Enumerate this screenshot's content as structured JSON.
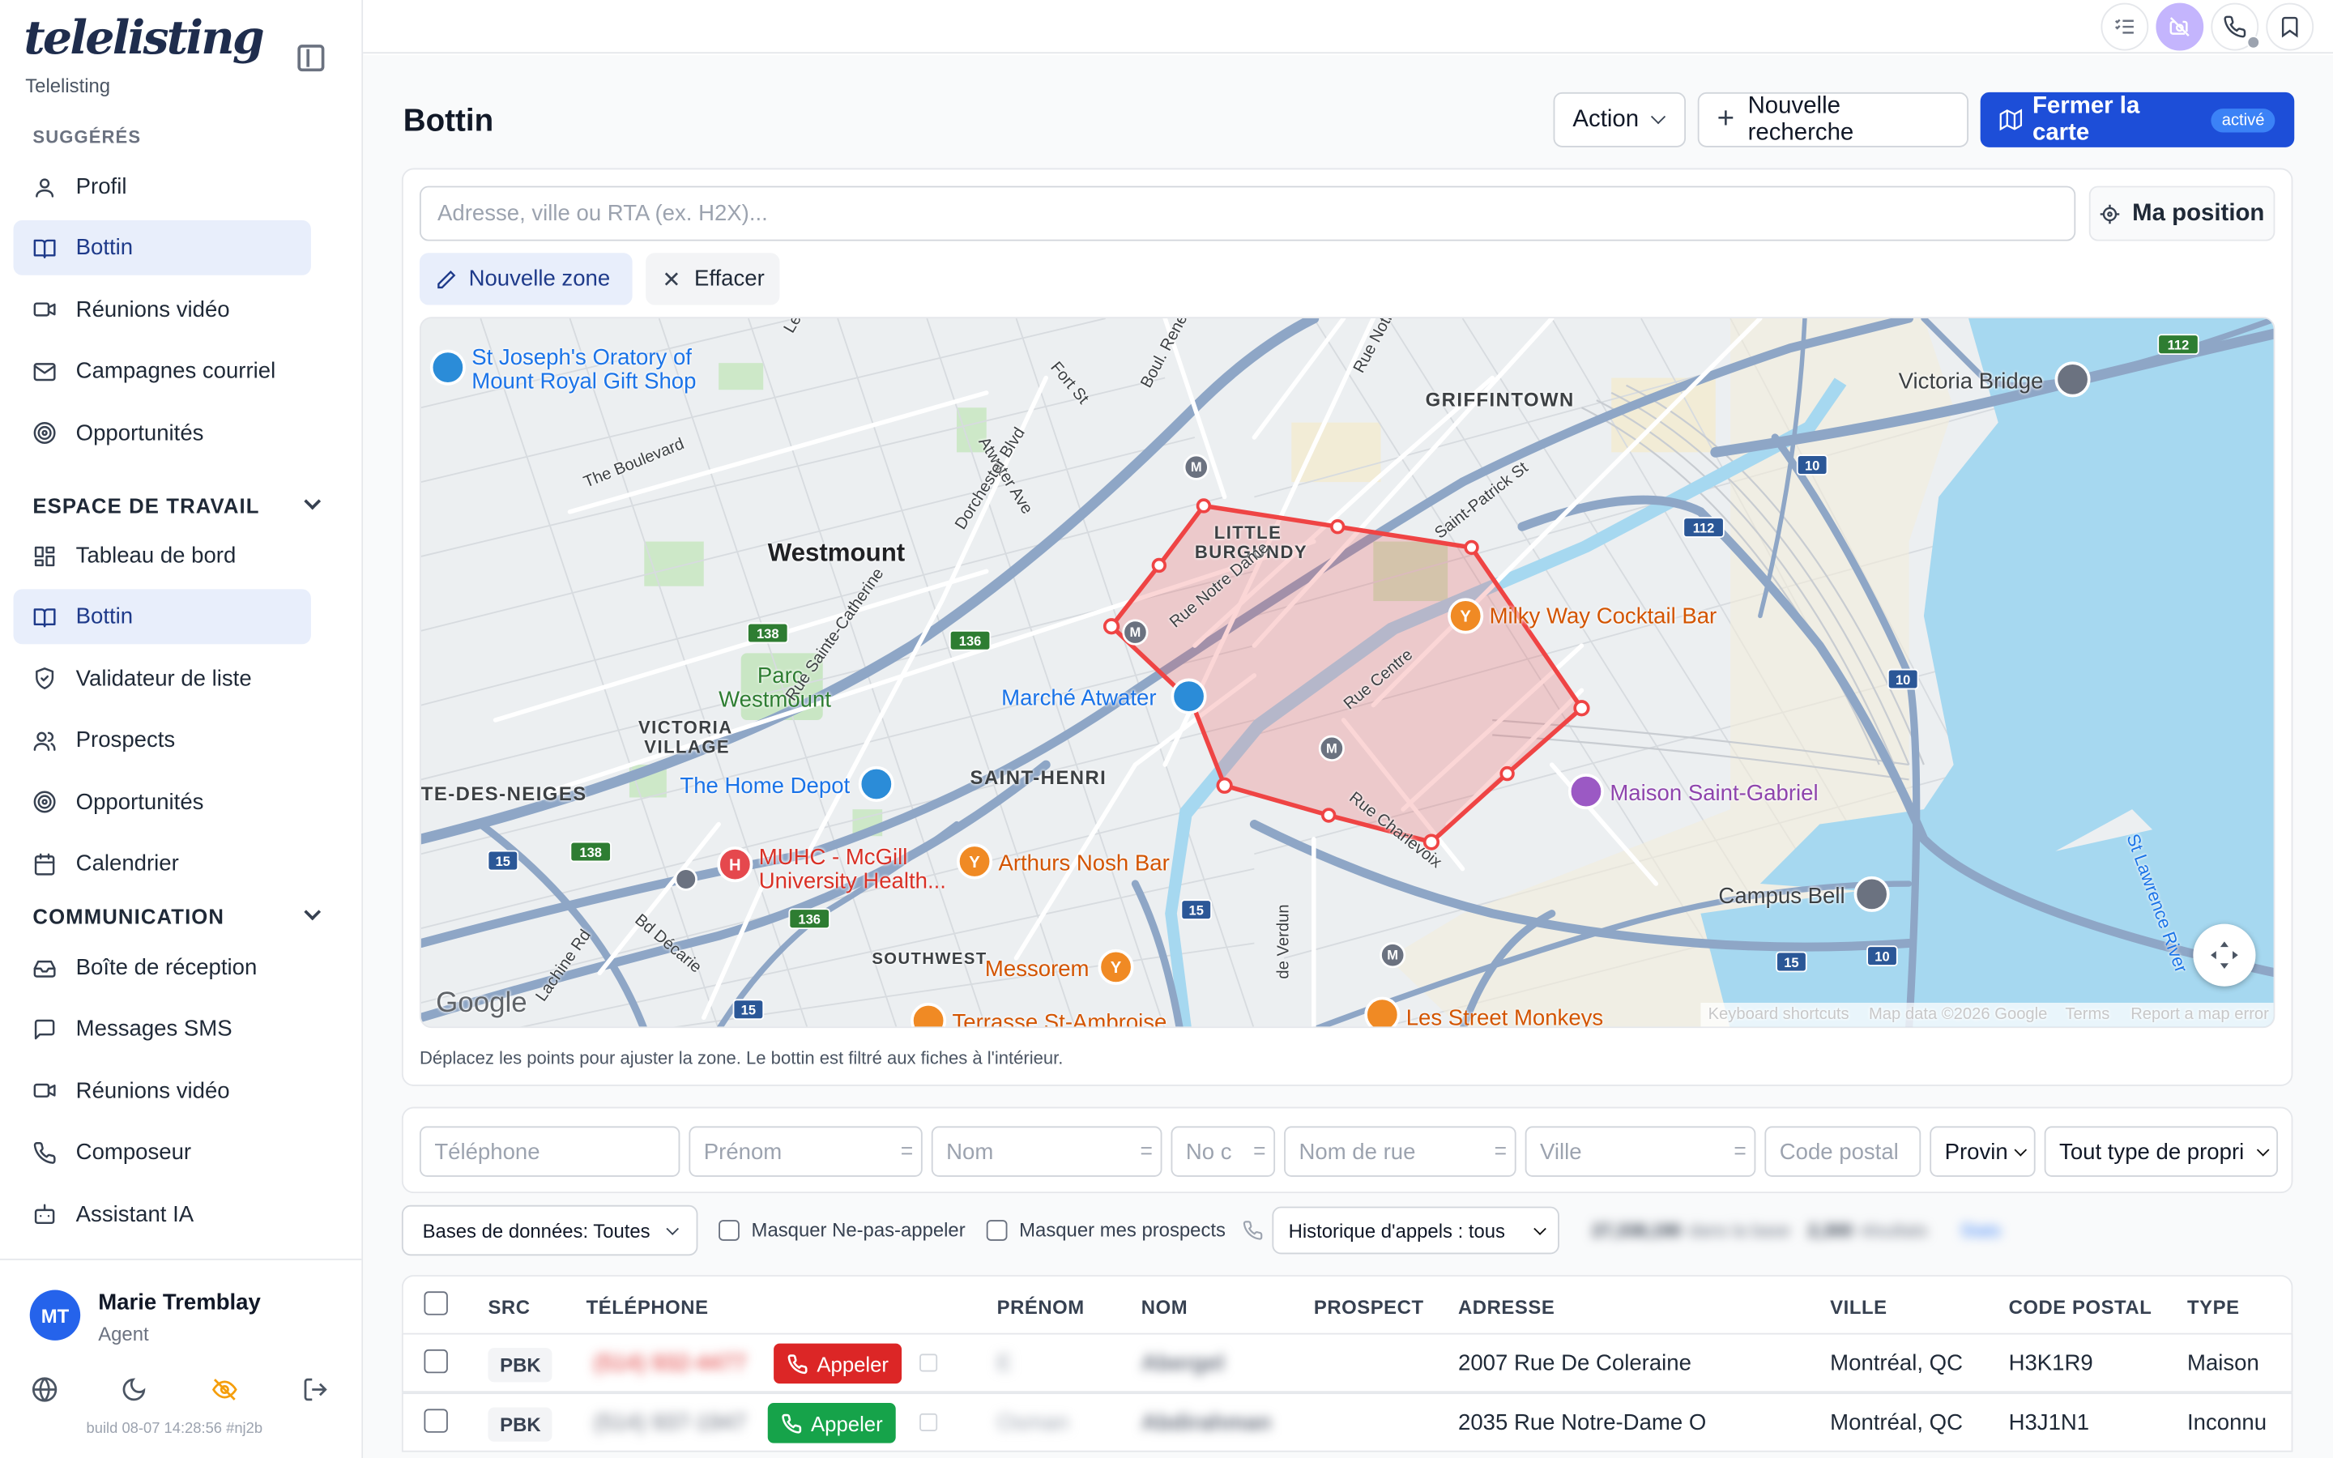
{
  "sidebar": {
    "logo": "telelisting",
    "brand_name": "Telelisting",
    "suggested_label": "SUGGÉRÉS",
    "suggested": [
      {
        "label": "Profil",
        "icon": "user-icon"
      },
      {
        "label": "Bottin",
        "icon": "book-icon",
        "active": true
      },
      {
        "label": "Réunions vidéo",
        "icon": "video-icon"
      },
      {
        "label": "Campagnes courriel",
        "icon": "mail-icon"
      },
      {
        "label": "Opportunités",
        "icon": "target-icon"
      }
    ],
    "workspace_label": "ESPACE DE TRAVAIL",
    "workspace": [
      {
        "label": "Tableau de bord",
        "icon": "dashboard-icon"
      },
      {
        "label": "Bottin",
        "icon": "book-icon",
        "active": true
      },
      {
        "label": "Validateur de liste",
        "icon": "shield-check-icon"
      },
      {
        "label": "Prospects",
        "icon": "users-icon"
      },
      {
        "label": "Opportunités",
        "icon": "target-icon"
      },
      {
        "label": "Calendrier",
        "icon": "calendar-icon"
      }
    ],
    "communication_label": "COMMUNICATION",
    "communication": [
      {
        "label": "Boîte de réception",
        "icon": "inbox-icon"
      },
      {
        "label": "Messages SMS",
        "icon": "message-icon"
      },
      {
        "label": "Réunions vidéo",
        "icon": "video-icon"
      },
      {
        "label": "Composeur",
        "icon": "phone-icon"
      },
      {
        "label": "Assistant IA",
        "icon": "bot-icon"
      }
    ],
    "user": {
      "initials": "MT",
      "name": "Marie Tremblay",
      "role": "Agent"
    },
    "build": "build 08-07 14:28:56 #nj2b"
  },
  "header": {
    "title": "Bottin",
    "action_label": "Action",
    "new_search_label": "Nouvelle recherche",
    "close_map_label": "Fermer la carte",
    "close_map_badge": "activé"
  },
  "map_panel": {
    "search_placeholder": "Adresse, ville ou RTA (ex. H2X)...",
    "my_position_label": "Ma position",
    "new_zone_label": "Nouvelle zone",
    "clear_label": "Effacer",
    "hint": "Déplacez les points pour ajuster la zone. Le bottin est filtré aux fiches à l'intérieur.",
    "labels": {
      "westmount": "Westmount",
      "griffintown": "GRIFFINTOWN",
      "little_burgundy_1": "LITTLE",
      "little_burgundy_2": "BURGUNDY",
      "victoria_village_1": "VICTORIA",
      "victoria_village_2": "VILLAGE",
      "saint_henri": "SAINT-HENRI",
      "cote_des_neiges": "TE-DES-NEIGES",
      "southwest": "SOUTHWEST",
      "parc_1": "Parc",
      "parc_2": "Westmount",
      "oratory_1": "St Joseph's Oratory of",
      "oratory_2": "Mount Royal Gift Shop",
      "victoria_bridge": "Victoria Bridge",
      "milky_way": "Milky Way Cocktail Bar",
      "marche": "Marché Atwater",
      "home_depot": "The Home Depot",
      "muhc_1": "MUHC - McGill",
      "muhc_2": "University Health...",
      "arthurs": "Arthurs Nosh Bar",
      "maison": "Maison Saint-Gabriel",
      "campus_bell": "Campus Bell",
      "messorem": "Messorem",
      "terrasse": "Terrasse St-Ambroise",
      "street_monkeys": "Les Street Monkeys",
      "st_lawrence": "St Lawrence River",
      "the_boulevard": "The Boulevard",
      "atwater_ave": "Atwater Ave",
      "dorchester": "Dorchester Blvd",
      "ste_catherine": "Rue Sainte-Catherine",
      "notre_dame": "Rue Notre Dame",
      "rue_centre": "Rue Centre",
      "charlevoix": "Rue Charlevoix",
      "saint_patrick": "Saint-Patrick St",
      "rue_notre_dam2": "Rue Notre Dam",
      "fort_st": "Fort St",
      "rene_levesque": "Boul. René-Lévesque",
      "le_b": "Le B",
      "decarie": "Bd Décarie",
      "lachine": "Lachine Rd",
      "verdun": "de Verdun",
      "google": "Google",
      "shortcuts": "Keyboard shortcuts",
      "map_data": "Map data ©2026 Google",
      "terms": "Terms",
      "report": "Report a map error"
    },
    "highway_shields": [
      "138",
      "136",
      "112",
      "10",
      "112",
      "10",
      "15",
      "138",
      "136",
      "15",
      "15",
      "10",
      "15"
    ]
  },
  "filters": {
    "telephone": "Téléphone",
    "prenom": "Prénom",
    "nom": "Nom",
    "no_civique": "No c",
    "nom_rue": "Nom de rue",
    "ville": "Ville",
    "code_postal": "Code postal",
    "province": "Provin",
    "type": "Tout type de propri",
    "databases": "Bases de données: Toutes",
    "hide_dnc": "Masquer Ne-pas-appeler",
    "hide_prospects": "Masquer mes prospects",
    "call_history": "Historique d'appels : tous",
    "count_base": "27,338,190",
    "count_base_suffix": "dans la base",
    "count_results": "2,300",
    "count_results_suffix": "résultats",
    "stats_label": "Stats"
  },
  "table": {
    "headers": [
      "SRC",
      "TÉLÉPHONE",
      "PRÉNOM",
      "NOM",
      "PROSPECT",
      "ADRESSE",
      "VILLE",
      "CODE POSTAL",
      "TYPE"
    ],
    "call_label": "Appeler",
    "rows": [
      {
        "src": "PBK",
        "phone": "(514) 932-4477",
        "firstname": "E",
        "lastname": "Abergel",
        "prospect": "",
        "address": "2007 Rue De Coleraine",
        "city": "Montréal, QC",
        "postal": "H3K1R9",
        "type": "Maison",
        "call_color": "#dc2626"
      },
      {
        "src": "PBK",
        "phone": "(514) 937-1947",
        "firstname": "Osman",
        "lastname": "Abdirahman",
        "prospect": "",
        "address": "2035 Rue Notre-Dame O",
        "city": "Montréal, QC",
        "postal": "H3J1N1",
        "type": "Inconnu",
        "call_color": "#16a34a"
      }
    ]
  },
  "colors": {
    "accent": "#1d4ed8",
    "zone": "#ef4444",
    "water": "#a6d8f0",
    "call_red": "#dc2626",
    "call_green": "#16a34a"
  }
}
